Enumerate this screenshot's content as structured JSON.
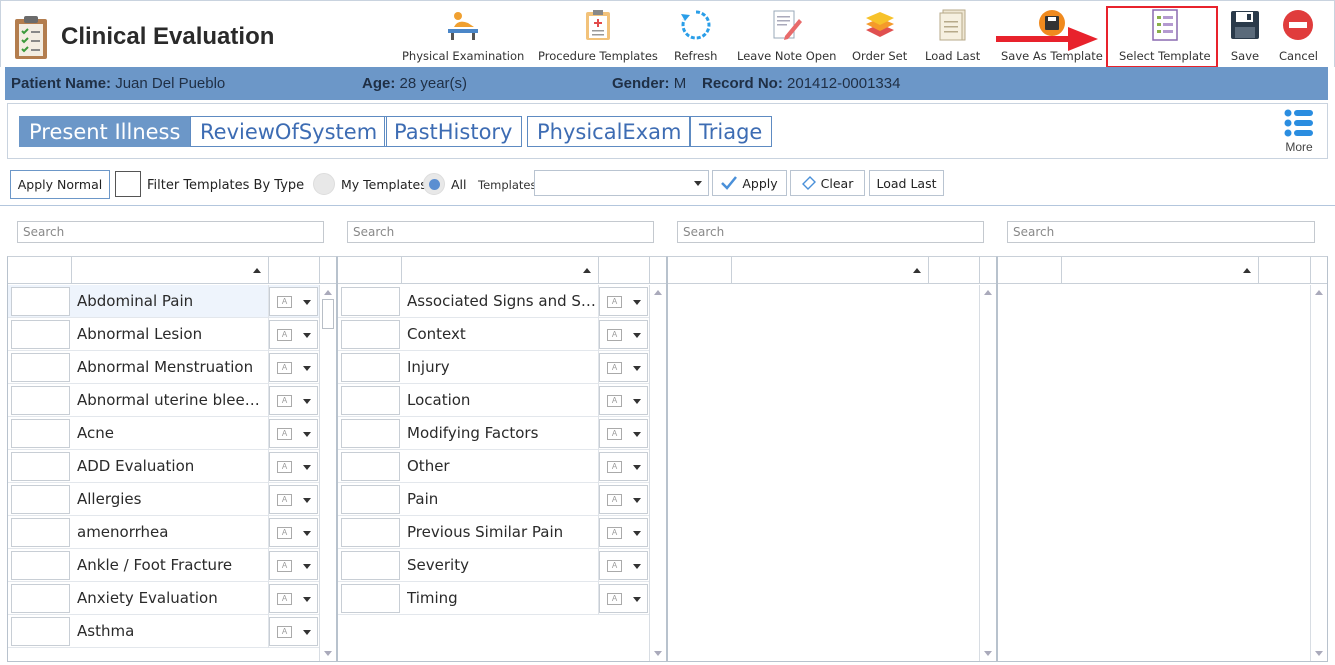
{
  "app": {
    "title": "Clinical Evaluation"
  },
  "toolbar": {
    "physical_examination": "Physical Examination",
    "procedure_templates": "Procedure Templates",
    "refresh": "Refresh",
    "leave_note_open": "Leave Note Open",
    "order_set": "Order Set",
    "load_last": "Load Last",
    "save_as_template": "Save As Template",
    "select_template": "Select Template",
    "save": "Save",
    "cancel": "Cancel"
  },
  "patient": {
    "name_label": "Patient Name:",
    "name": "Juan Del Pueblo",
    "age_label": "Age:",
    "age": "28 year(s)",
    "gender_label": "Gender:",
    "gender": "M",
    "record_label": "Record No:",
    "record": "201412-0001334"
  },
  "tabs": [
    "Present Illness",
    "ReviewOfSystem",
    "PastHistory",
    "PhysicalExam",
    "Triage"
  ],
  "more_label": "More",
  "filter": {
    "apply_normal": "Apply Normal",
    "filter_by_type": "Filter Templates By Type",
    "my_templates": "My Templates",
    "all": "All",
    "templates_label": "Templates:",
    "templates_value": "",
    "apply": "Apply",
    "clear": "Clear",
    "load_last": "Load Last"
  },
  "search_placeholder": "Search",
  "panel1_items": [
    "Abdominal Pain",
    "Abnormal Lesion",
    "Abnormal Menstruation",
    "Abnormal uterine bleedi...",
    "Acne",
    "ADD Evaluation",
    "Allergies",
    "amenorrhea",
    "Ankle / Foot Fracture",
    "Anxiety Evaluation",
    "Asthma"
  ],
  "panel2_items": [
    "Associated Signs and Sy...",
    "Context",
    "Injury",
    "Location",
    "Modifying Factors",
    "Other",
    "Pain",
    "Previous Similar Pain",
    "Severity",
    "Timing"
  ],
  "colors": {
    "accent": "#6c97c8",
    "highlight": "#e8222c"
  }
}
